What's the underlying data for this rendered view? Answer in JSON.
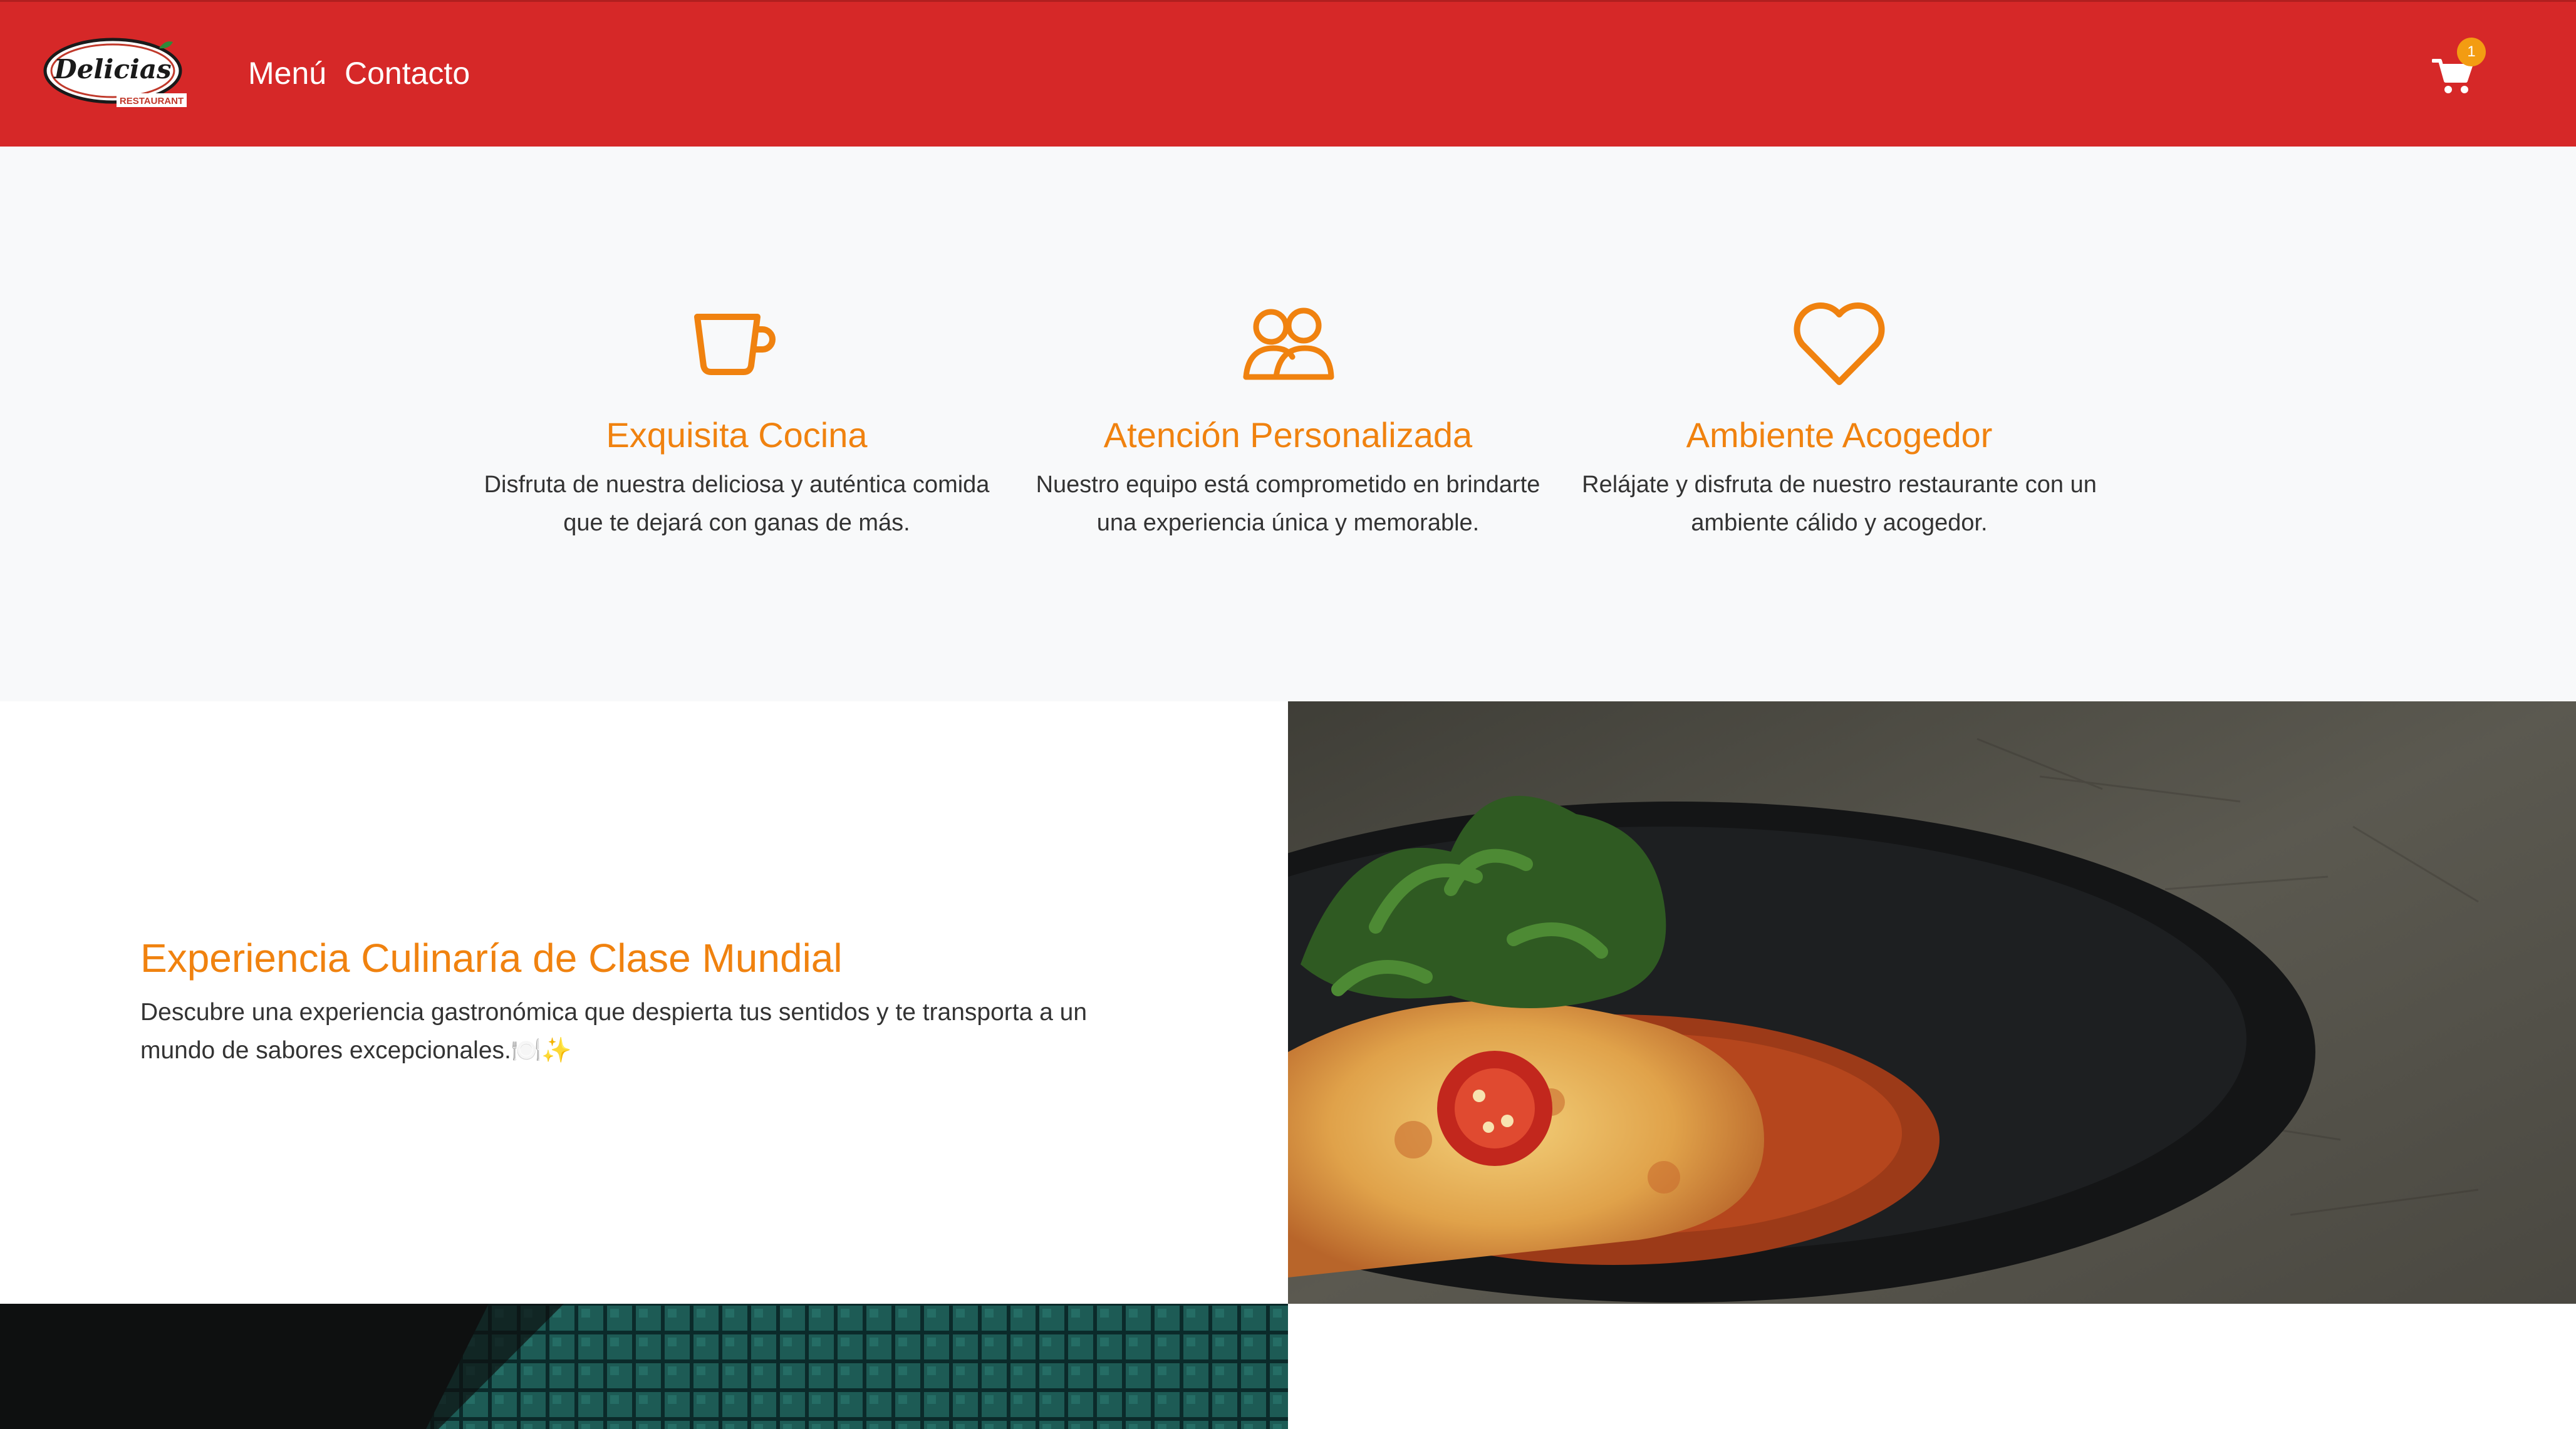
{
  "navbar": {
    "logo_text": "Delicias",
    "logo_subtext": "RESTAURANT",
    "links": [
      {
        "label": "Menú"
      },
      {
        "label": "Contacto"
      }
    ],
    "cart_count": "1",
    "icons": {
      "cart": "shopping-cart-icon"
    }
  },
  "colors": {
    "navbar": "#d62828",
    "accent": "#f0820f",
    "badge": "#f39c12",
    "features_bg": "#f8f9fa"
  },
  "features": [
    {
      "icon": "coffee-cup-icon",
      "title": "Exquisita Cocina",
      "description": "Disfruta de nuestra deliciosa y auténtica comida que te dejará con ganas de más."
    },
    {
      "icon": "users-icon",
      "title": "Atención Personalizada",
      "description": "Nuestro equipo está comprometido en brindarte una experiencia única y memorable."
    },
    {
      "icon": "heart-icon",
      "title": "Ambiente Acogedor",
      "description": "Relájate y disfruta de nuestro restaurante con un ambiente cálido y acogedor."
    }
  ],
  "experience": {
    "title": "Experiencia Culinaría de Clase Mundial",
    "description": "Descubre una experiencia gastronómica que despierta tus sentidos y te transporta a un mundo de sabores excepcionales.🍽️✨"
  }
}
